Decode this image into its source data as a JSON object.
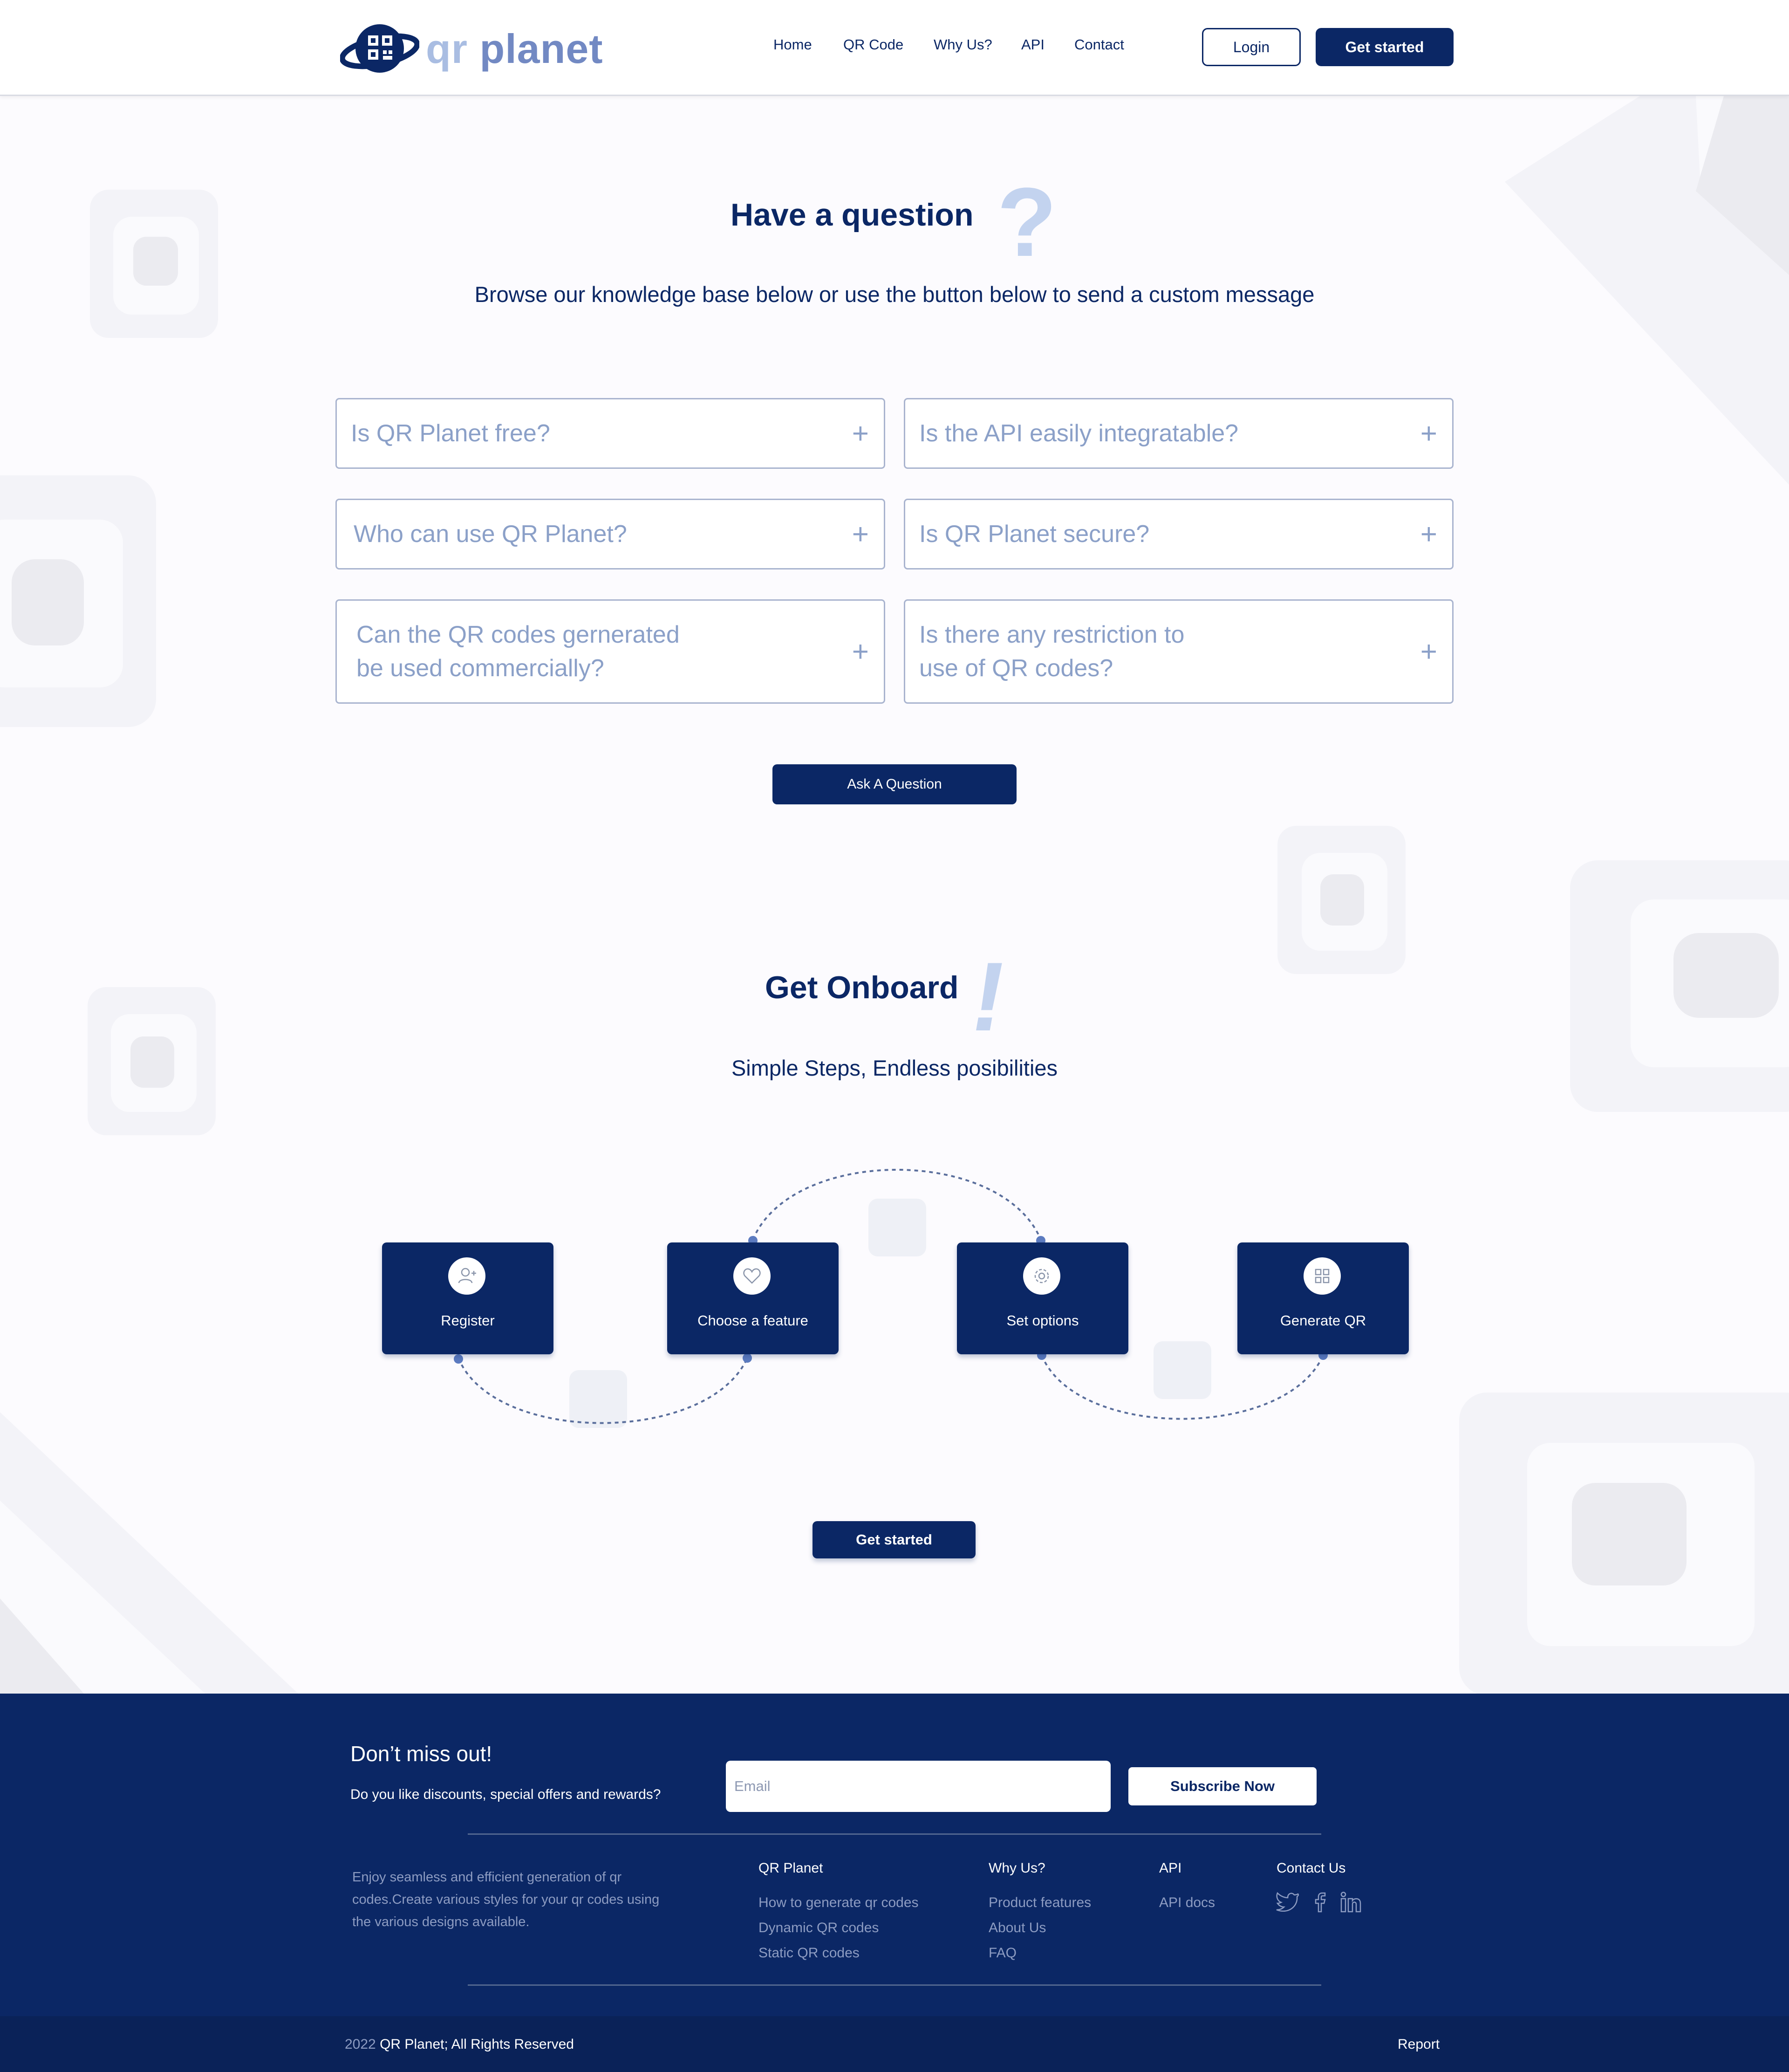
{
  "header": {
    "logo": {
      "part1": "qr",
      "part2": "planet"
    },
    "nav": [
      "Home",
      "QR Code",
      "Why Us?",
      "API",
      "Contact"
    ],
    "login_label": "Login",
    "get_started_label": "Get started"
  },
  "faq_section": {
    "title": "Have a question",
    "mark": "?",
    "subtitle": "Browse our knowledge base below or use the button below to send a custom message",
    "questions": [
      {
        "line1": "Is QR Planet free?",
        "line2": ""
      },
      {
        "line1": "Is the API easily integratable?",
        "line2": ""
      },
      {
        "line1": "Who can use QR Planet?",
        "line2": ""
      },
      {
        "line1": "Is QR Planet secure?",
        "line2": ""
      },
      {
        "line1": "Can the QR codes gernerated",
        "line2": "be used commercially?"
      },
      {
        "line1": "Is there any restriction to",
        "line2": "use of QR codes?"
      }
    ],
    "plus": "+",
    "ask_label": "Ask A Question"
  },
  "onboard_section": {
    "title": "Get Onboard",
    "mark": "!",
    "subtitle": "Simple Steps, Endless posibilities",
    "steps": [
      {
        "label": "Register",
        "icon": "add-user-icon"
      },
      {
        "label": "Choose a feature",
        "icon": "heart-icon"
      },
      {
        "label": "Set options",
        "icon": "gear-icon"
      },
      {
        "label": "Generate QR",
        "icon": "grid-icon"
      }
    ],
    "get_started_label": "Get started"
  },
  "footer": {
    "newsletter_title": "Don’t miss out!",
    "newsletter_sub": "Do you like discounts, special offers and rewards?",
    "email_placeholder": "Email",
    "subscribe_label": "Subscribe Now",
    "about_lines": [
      "Enjoy seamless and efficient generation of qr",
      "codes.Create various styles for your qr codes using",
      "the various designs available."
    ],
    "columns": [
      {
        "heading": "QR Planet",
        "links": [
          "How to generate qr codes",
          "Dynamic QR codes",
          "Static QR codes"
        ]
      },
      {
        "heading": "Why Us?",
        "links": [
          "Product features",
          "About Us",
          "FAQ"
        ]
      },
      {
        "heading": "API",
        "links": [
          "API docs"
        ]
      },
      {
        "heading": "Contact Us",
        "links": []
      }
    ],
    "social": [
      "twitter-icon",
      "facebook-icon",
      "linkedin-icon"
    ],
    "copyright_year": "2022",
    "copyright_text": "QR Planet;  All Rights Reserved",
    "report_label": "Report"
  },
  "colors": {
    "primary": "#0b2765",
    "muted": "#8ba0c8",
    "background": "#fcfbfe",
    "accent_light": "#c3d3ef"
  }
}
